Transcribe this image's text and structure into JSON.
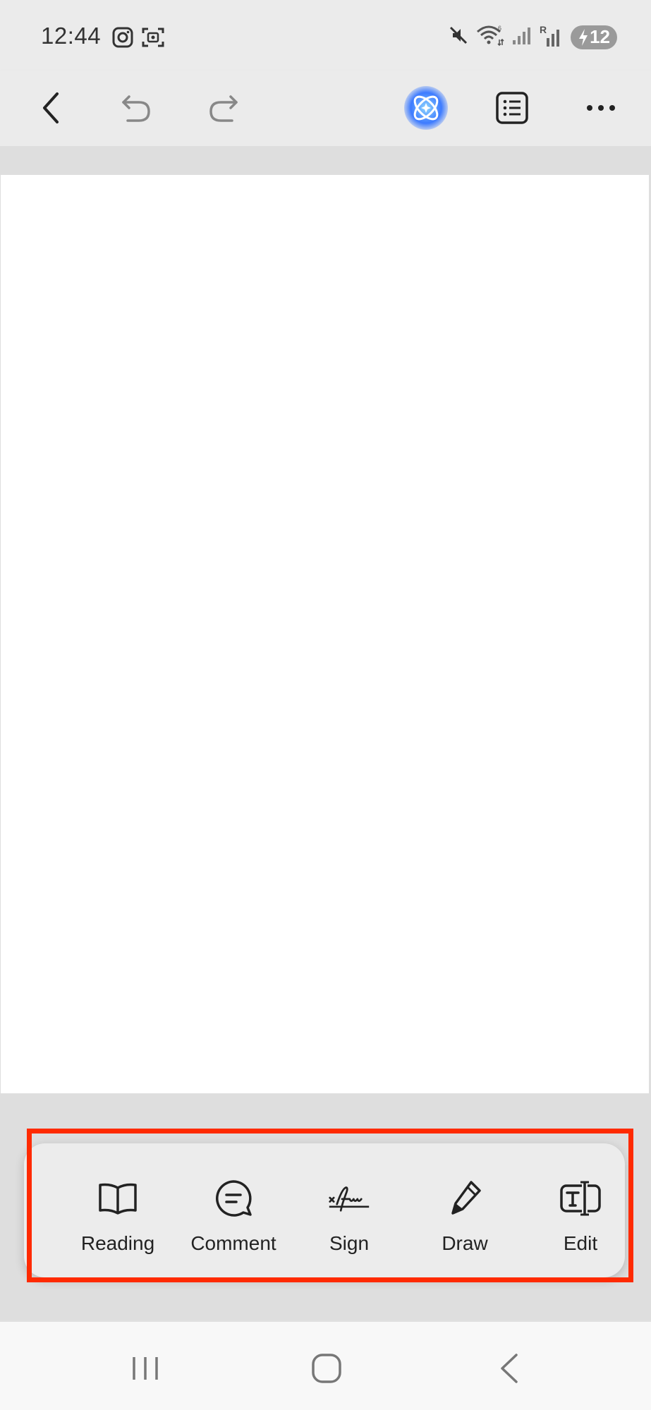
{
  "status_bar": {
    "time": "12:44",
    "left_icons": [
      "instagram-icon",
      "screenshot-icon"
    ],
    "right_icons": [
      "mute-icon",
      "wifi-icon",
      "signal-icon",
      "roaming-signal-icon"
    ],
    "roaming_label": "R",
    "battery_level": "12",
    "battery_charging": true
  },
  "toolbar": {
    "buttons": [
      "back-icon",
      "undo-icon",
      "redo-icon",
      "ai-assistant-icon",
      "outline-icon",
      "more-icon"
    ],
    "ai_colors": [
      "#3d7bff",
      "#8fd6ff"
    ]
  },
  "mode_bar": {
    "highlight_color": "#ff2a00",
    "items": [
      {
        "label": "Reading",
        "icon": "book-icon"
      },
      {
        "label": "Comment",
        "icon": "comment-icon"
      },
      {
        "label": "Sign",
        "icon": "signature-icon"
      },
      {
        "label": "Draw",
        "icon": "pen-icon"
      },
      {
        "label": "Edit",
        "icon": "text-edit-icon"
      }
    ]
  },
  "nav_bar": {
    "buttons": [
      "recent-apps-icon",
      "home-icon",
      "nav-back-icon"
    ]
  }
}
